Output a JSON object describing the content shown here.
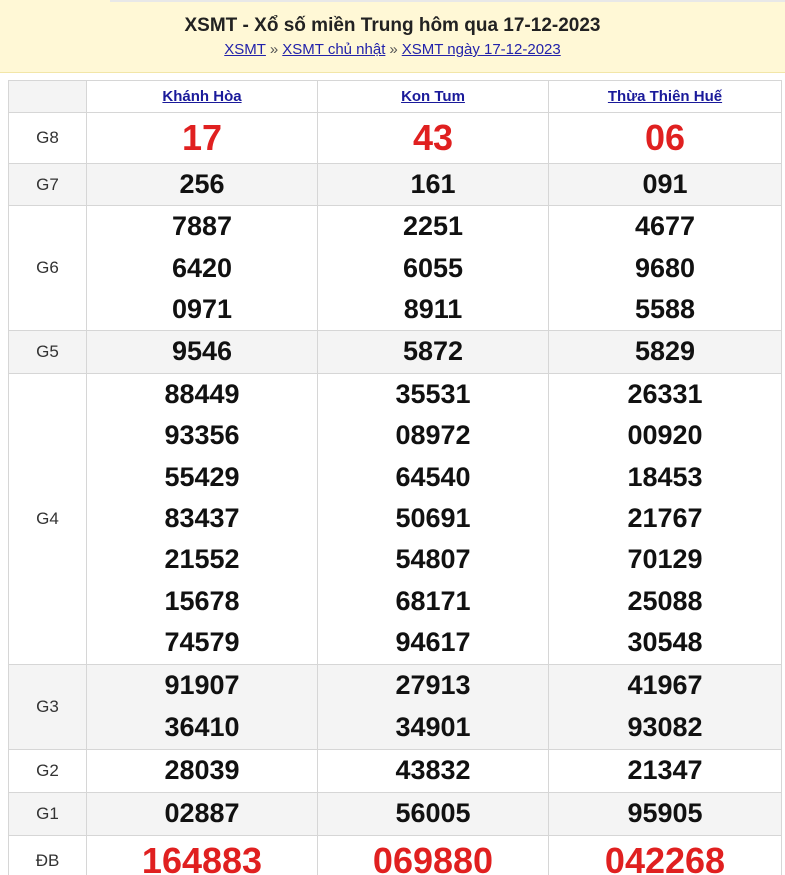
{
  "header": {
    "title": "XSMT - Xổ số miền Trung hôm qua 17-12-2023",
    "crumbs": [
      "XSMT",
      "XSMT chủ nhật",
      "XSMT ngày 17-12-2023"
    ],
    "separator": "»"
  },
  "provinces": [
    "Khánh Hòa",
    "Kon Tum",
    "Thừa Thiên Huế"
  ],
  "prizes": {
    "g8": {
      "label": "G8",
      "values": [
        [
          "17"
        ],
        [
          "43"
        ],
        [
          "06"
        ]
      ]
    },
    "g7": {
      "label": "G7",
      "values": [
        [
          "256"
        ],
        [
          "161"
        ],
        [
          "091"
        ]
      ]
    },
    "g6": {
      "label": "G6",
      "values": [
        [
          "7887",
          "6420",
          "0971"
        ],
        [
          "2251",
          "6055",
          "8911"
        ],
        [
          "4677",
          "9680",
          "5588"
        ]
      ]
    },
    "g5": {
      "label": "G5",
      "values": [
        [
          "9546"
        ],
        [
          "5872"
        ],
        [
          "5829"
        ]
      ]
    },
    "g4": {
      "label": "G4",
      "values": [
        [
          "88449",
          "93356",
          "55429",
          "83437",
          "21552",
          "15678",
          "74579"
        ],
        [
          "35531",
          "08972",
          "64540",
          "50691",
          "54807",
          "68171",
          "94617"
        ],
        [
          "26331",
          "00920",
          "18453",
          "21767",
          "70129",
          "25088",
          "30548"
        ]
      ]
    },
    "g3": {
      "label": "G3",
      "values": [
        [
          "91907",
          "36410"
        ],
        [
          "27913",
          "34901"
        ],
        [
          "41967",
          "93082"
        ]
      ]
    },
    "g2": {
      "label": "G2",
      "values": [
        [
          "28039"
        ],
        [
          "43832"
        ],
        [
          "21347"
        ]
      ]
    },
    "g1": {
      "label": "G1",
      "values": [
        [
          "02887"
        ],
        [
          "56005"
        ],
        [
          "95905"
        ]
      ]
    },
    "db": {
      "label": "ĐB",
      "values": [
        [
          "164883"
        ],
        [
          "069880"
        ],
        [
          "042268"
        ]
      ]
    }
  },
  "colors": {
    "header_bg": "#fff8d6",
    "highlight_red": "#e02020",
    "link_blue": "#1a1a9a",
    "alt_row_bg": "#f4f4f4"
  }
}
